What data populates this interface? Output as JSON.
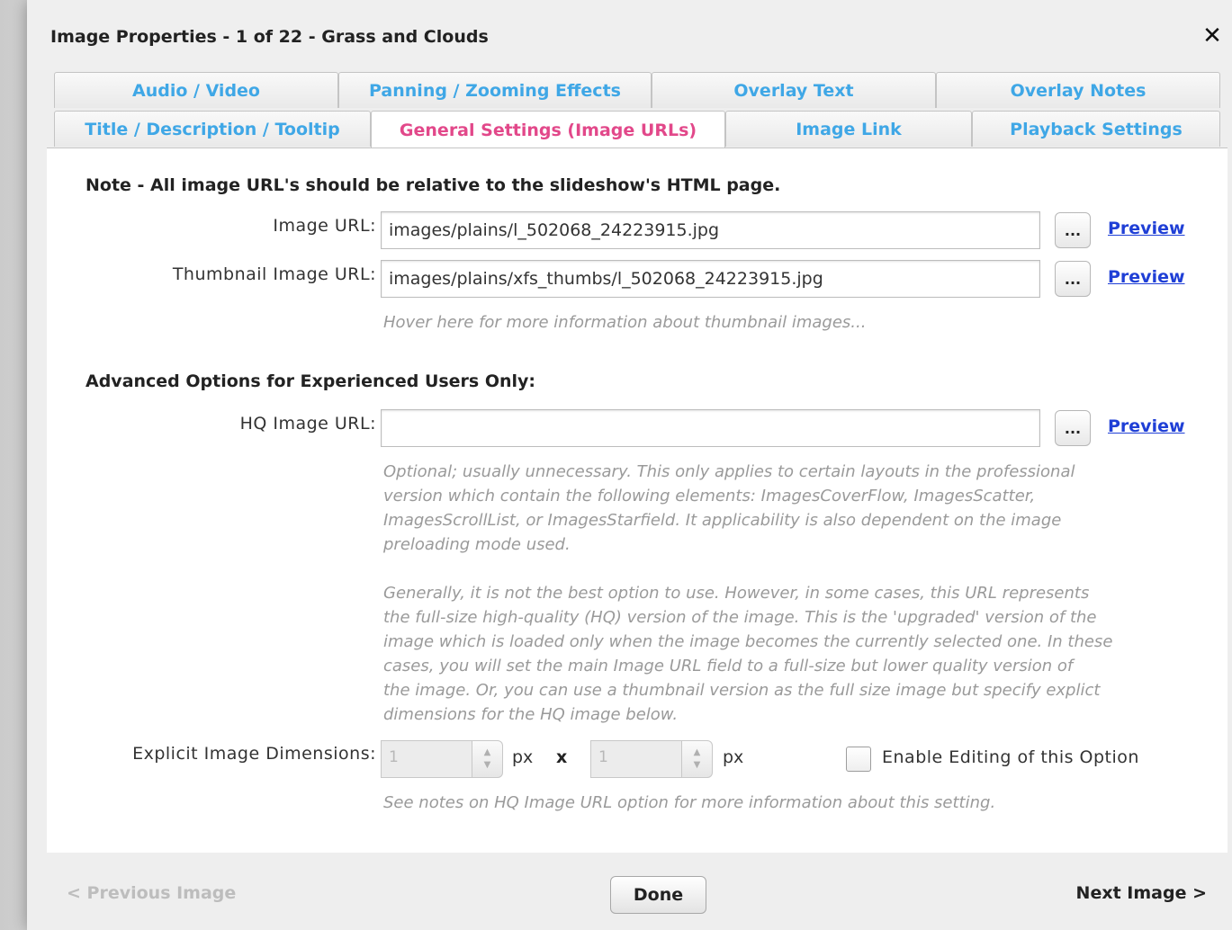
{
  "dialog": {
    "title": "Image Properties - 1 of 22 - Grass and Clouds",
    "close_glyph": "✕"
  },
  "tabs": {
    "row1": [
      "Audio / Video",
      "Panning / Zooming Effects",
      "Overlay Text",
      "Overlay Notes"
    ],
    "row2": [
      "Title / Description / Tooltip",
      "General Settings (Image URLs)",
      "Image Link",
      "Playback Settings"
    ],
    "active": "General Settings (Image URLs)"
  },
  "general": {
    "note": "Note - All image URL's should be relative to the slideshow's HTML page.",
    "image_url_label": "Image URL:",
    "image_url_value": "images/plains/l_502068_24223915.jpg",
    "thumb_url_label": "Thumbnail Image URL:",
    "thumb_url_value": "images/plains/xfs_thumbs/l_502068_24223915.jpg",
    "thumb_hint": "Hover here for more information about thumbnail images...",
    "browse_label": "...",
    "preview_label": "Preview"
  },
  "advanced": {
    "heading": "Advanced Options for Experienced Users Only:",
    "hq_label": "HQ Image URL:",
    "hq_value": "",
    "hint1_lines": [
      "Optional; usually unnecessary.  This only applies to certain layouts in the professional",
      "version which contain the following elements: ImagesCoverFlow, ImagesScatter,",
      "ImagesScrollList, or ImagesStarfield.  It applicability is also dependent on the image",
      "preloading mode used."
    ],
    "hint2_lines": [
      "Generally, it is not the best option to use.  However, in some cases, this URL represents",
      "the full-size high-quality (HQ) version of the image.  This is the 'upgraded' version of the",
      "image which is loaded only when the image becomes the currently selected one.  In these",
      "cases, you will set the main Image URL field to a full-size but lower quality version of",
      "the image.  Or, you can use a thumbnail version as the full size image but specify explict",
      "dimensions for the HQ image below."
    ],
    "dims_label": "Explicit Image Dimensions:",
    "width_value": "1",
    "height_value": "1",
    "unit": "px",
    "times": "x",
    "enable_label": "Enable Editing of this Option",
    "enable_checked": false,
    "dims_hint": "See notes on HQ Image URL option for more information about this setting."
  },
  "footer": {
    "prev_label": "< Previous Image",
    "done_label": "Done",
    "next_label": "Next Image >"
  },
  "colors": {
    "tab_text": "#3fa7e6",
    "tab_active_text": "#e2488a",
    "link": "#1f3fd6"
  }
}
